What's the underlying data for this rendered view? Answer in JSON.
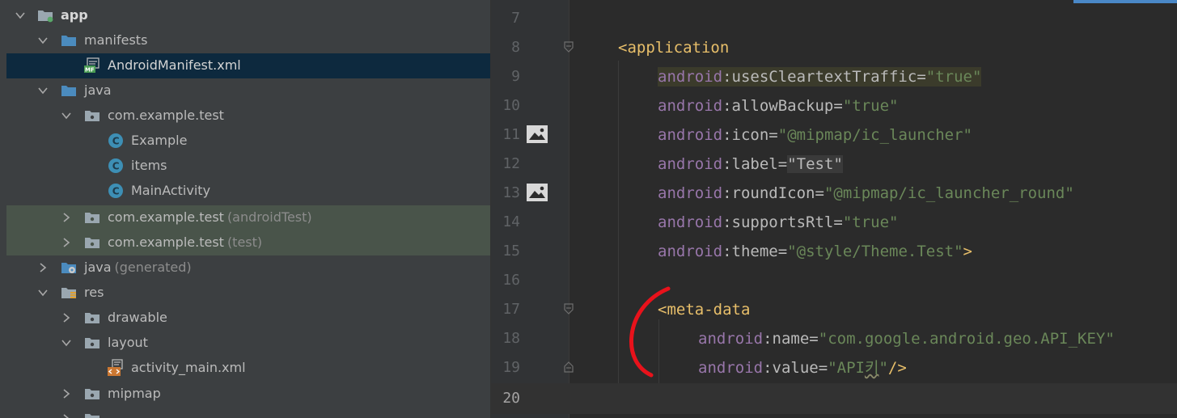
{
  "project_tree": {
    "items": [
      {
        "label": "app",
        "suffix": "",
        "icon": "module-folder-icon",
        "expanded": true
      },
      {
        "label": "manifests",
        "suffix": "",
        "icon": "folder-icon",
        "expanded": true
      },
      {
        "label": "AndroidManifest.xml",
        "suffix": "",
        "icon": "manifest-file-icon",
        "selected": true
      },
      {
        "label": "java",
        "suffix": "",
        "icon": "folder-icon",
        "expanded": true
      },
      {
        "label": "com.example.test",
        "suffix": "",
        "icon": "package-icon",
        "expanded": true
      },
      {
        "label": "Example",
        "suffix": "",
        "icon": "class-icon"
      },
      {
        "label": "items",
        "suffix": "",
        "icon": "class-icon"
      },
      {
        "label": "MainActivity",
        "suffix": "",
        "icon": "class-icon"
      },
      {
        "label": "com.example.test",
        "suffix": "(androidTest)",
        "icon": "package-icon",
        "expanded": false
      },
      {
        "label": "com.example.test",
        "suffix": "(test)",
        "icon": "package-icon",
        "expanded": false
      },
      {
        "label": "java",
        "suffix": "(generated)",
        "icon": "generated-folder-icon",
        "expanded": false
      },
      {
        "label": "res",
        "suffix": "",
        "icon": "res-folder-icon",
        "expanded": true
      },
      {
        "label": "drawable",
        "suffix": "",
        "icon": "folder-icon",
        "expanded": false
      },
      {
        "label": "layout",
        "suffix": "",
        "icon": "folder-icon",
        "expanded": true
      },
      {
        "label": "activity_main.xml",
        "suffix": "",
        "icon": "layout-file-icon"
      },
      {
        "label": "mipmap",
        "suffix": "",
        "icon": "folder-icon",
        "expanded": false
      }
    ]
  },
  "editor": {
    "current_line": "20",
    "lines": [
      {
        "number": "7"
      },
      {
        "number": "8",
        "tag_open": "<application"
      },
      {
        "number": "9",
        "ns": "android",
        "attr": "usesCleartextTraffic",
        "value": "\"true\""
      },
      {
        "number": "10",
        "ns": "android",
        "attr": "allowBackup",
        "value": "\"true\""
      },
      {
        "number": "11",
        "ns": "android",
        "attr": "icon",
        "value": "\"@mipmap/ic_launcher\""
      },
      {
        "number": "12",
        "ns": "android",
        "attr": "label",
        "value": "\"Test\""
      },
      {
        "number": "13",
        "ns": "android",
        "attr": "roundIcon",
        "value": "\"@mipmap/ic_launcher_round\""
      },
      {
        "number": "14",
        "ns": "android",
        "attr": "supportsRtl",
        "value": "\"true\""
      },
      {
        "number": "15",
        "ns": "android",
        "attr": "theme",
        "value": "\"@style/Theme.Test\"",
        "tail": ">"
      },
      {
        "number": "16"
      },
      {
        "number": "17",
        "tag_open": "<meta-data"
      },
      {
        "number": "18",
        "ns": "android",
        "attr": "name",
        "value": "\"com.google.android.geo.API_KEY\""
      },
      {
        "number": "19",
        "ns": "android",
        "attr": "value",
        "value_prefix": "\"API",
        "value_squiggle": "키",
        "value_suffix": "\"",
        "tail": "/>"
      },
      {
        "number": "20"
      }
    ],
    "colon": ":",
    "equals": "="
  },
  "colors": {
    "tree_background": "#3c3f41",
    "tree_selected": "#0d293e",
    "test_package_background": "#49544a",
    "editor_background": "#2b2b2b",
    "tag_color": "#e8bf6a",
    "namespace_color": "#9876aa",
    "value_color": "#6a8759",
    "annotation_red": "#e8121b"
  }
}
